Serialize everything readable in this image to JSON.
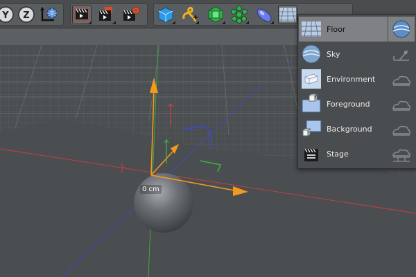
{
  "toolbar": {
    "groups": [
      {
        "name": "axis-lock-group",
        "buttons": [
          {
            "name": "y-axis-lock-button",
            "label": "Y"
          },
          {
            "name": "z-axis-lock-button",
            "label": "Z"
          },
          {
            "name": "coordinate-system-button",
            "icon": "world-axis-icon"
          }
        ]
      },
      {
        "name": "render-group",
        "buttons": [
          {
            "name": "render-view-button",
            "icon": "clapper-icon",
            "selected": true
          },
          {
            "name": "render-to-picture-viewer-button",
            "icon": "clapper-icon"
          },
          {
            "name": "render-settings-button",
            "icon": "clapper-gear-icon"
          }
        ]
      },
      {
        "name": "create-group",
        "buttons": [
          {
            "name": "cube-button",
            "icon": "cube-icon"
          },
          {
            "name": "spline-pen-button",
            "icon": "spline-icon"
          },
          {
            "name": "subdivision-surface-button",
            "icon": "subdivision-icon"
          },
          {
            "name": "array-button",
            "icon": "array-icon"
          },
          {
            "name": "deformer-button",
            "icon": "deformer-icon"
          },
          {
            "name": "floor-button",
            "icon": "floor-icon",
            "selected": true
          }
        ]
      }
    ]
  },
  "viewport": {
    "distance_label": "0 cm"
  },
  "environment_menu": {
    "items": [
      {
        "label": "Floor",
        "icon": "floor-icon",
        "highlighted": true
      },
      {
        "label": "Sky",
        "icon": "sky-icon"
      },
      {
        "label": "Environment",
        "icon": "environment-icon"
      },
      {
        "label": "Foreground",
        "icon": "foreground-icon"
      },
      {
        "label": "Background",
        "icon": "background-icon"
      },
      {
        "label": "Stage",
        "icon": "stage-icon"
      }
    ],
    "side_items": [
      {
        "icon": "physical-sky-icon"
      },
      {
        "icon": "sky-slider-icon"
      },
      {
        "icon": "cloud-icon"
      },
      {
        "icon": "cloud-icon"
      },
      {
        "icon": "cloud-icon"
      },
      {
        "icon": "cloud-tool-icon"
      }
    ]
  },
  "colors": {
    "x_axis": "#d23c3c",
    "y_axis": "#3fae3f",
    "z_axis": "#3a4ad0",
    "gizmo": "#f39a1e",
    "menu_highlight": "#7f8184"
  }
}
